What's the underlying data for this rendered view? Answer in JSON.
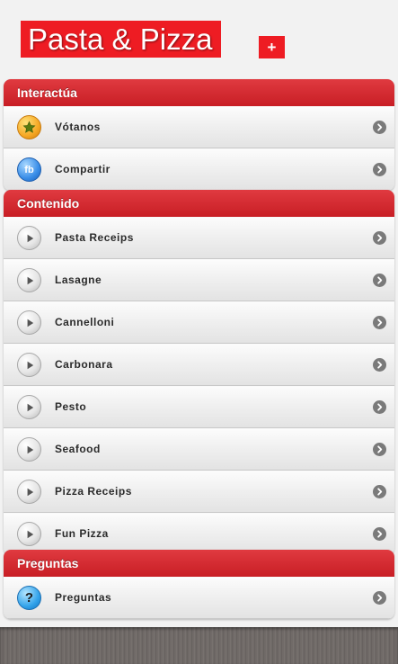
{
  "header": {
    "title": "Pasta & Pizza",
    "add_label": "+"
  },
  "groups": [
    {
      "title": "Interactúa",
      "items": [
        {
          "label": "Vótanos",
          "icon": "star-icon"
        },
        {
          "label": "Compartir",
          "icon": "facebook-icon",
          "icon_text": "fb"
        }
      ]
    },
    {
      "title": "Contenido",
      "items": [
        {
          "label": "Pasta Receips",
          "icon": "play-icon"
        },
        {
          "label": "Lasagne",
          "icon": "play-icon"
        },
        {
          "label": "Cannelloni",
          "icon": "play-icon"
        },
        {
          "label": "Carbonara",
          "icon": "play-icon"
        },
        {
          "label": "Pesto",
          "icon": "play-icon"
        },
        {
          "label": "Seafood",
          "icon": "play-icon"
        },
        {
          "label": "Pizza Receips",
          "icon": "play-icon"
        },
        {
          "label": "Fun Pizza",
          "icon": "play-icon"
        }
      ]
    },
    {
      "title": "Preguntas",
      "items": [
        {
          "label": "Preguntas",
          "icon": "question-icon",
          "icon_text": "?"
        }
      ]
    }
  ],
  "colors": {
    "brand_red": "#ee1c23",
    "header_red": "#c81e25",
    "text": "#2b2b2b",
    "chevron": "#7a7a7a"
  }
}
